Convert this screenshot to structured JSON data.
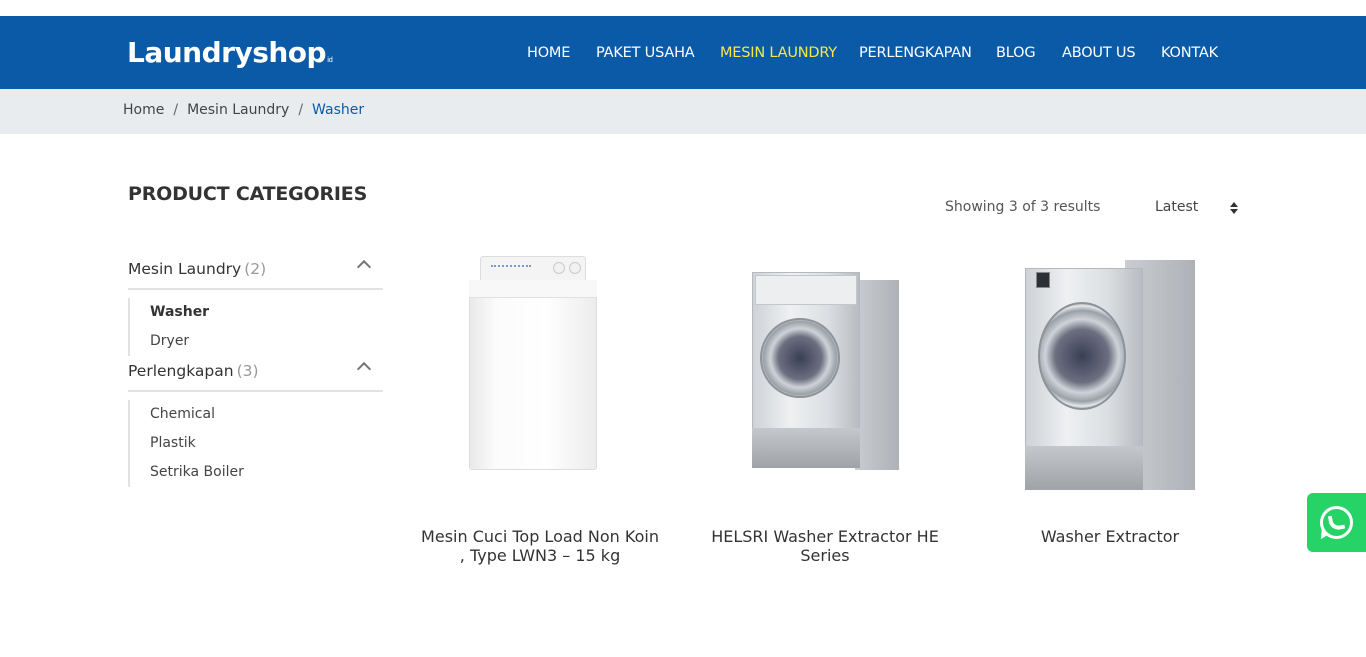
{
  "brand": {
    "logo_text": "Laundryshop",
    "logo_suffix": "id",
    "primary_color": "#0b5aa8",
    "active_nav_color": "#f5e94a"
  },
  "nav": {
    "items": [
      {
        "label": "HOME"
      },
      {
        "label": "PAKET USAHA"
      },
      {
        "label": "MESIN LAUNDRY",
        "active": true
      },
      {
        "label": "PERLENGKAPAN"
      },
      {
        "label": "BLOG"
      },
      {
        "label": "ABOUT US"
      },
      {
        "label": "KONTAK"
      }
    ]
  },
  "breadcrumb": {
    "items": [
      "Home",
      "Mesin Laundry",
      "Washer"
    ],
    "separator": "/"
  },
  "sidebar": {
    "title": "PRODUCT CATEGORIES",
    "groups": [
      {
        "label": "Mesin Laundry",
        "count": "(2)",
        "children": [
          "Washer",
          "Dryer"
        ],
        "active_child": "Washer"
      },
      {
        "label": "Perlengkapan",
        "count": "(3)",
        "children": [
          "Chemical",
          "Plastik",
          "Setrika Boiler"
        ]
      }
    ]
  },
  "toolbar": {
    "results_text": "Showing 3 of 3 results",
    "sort_selected": "Latest"
  },
  "products": [
    {
      "name": "Mesin Cuci Top Load Non Koin , Type LWN3 – 15 kg",
      "image": "top-load-washer"
    },
    {
      "name": "HELSRI Washer Extractor HE Series",
      "image": "front-load-washer-extractor"
    },
    {
      "name": "Washer Extractor",
      "image": "industrial-washer-extractor"
    }
  ],
  "floating": {
    "whatsapp_icon": "whatsapp-icon",
    "whatsapp_color": "#25d366"
  }
}
